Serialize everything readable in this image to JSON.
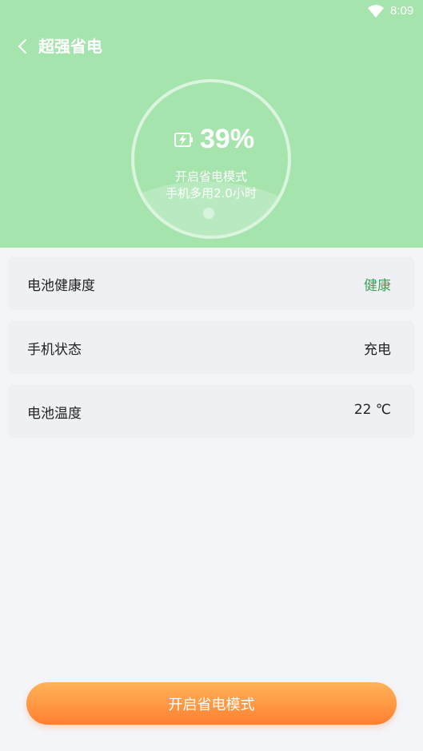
{
  "status_bar": {
    "time": "8:09",
    "wifi_icon": "wifi-icon"
  },
  "header": {
    "title": "超强省电",
    "back_icon": "chevron-left-icon",
    "background": "#a6e4ad"
  },
  "gauge": {
    "percent_text": "39%",
    "percent_value": 39,
    "icon": "battery-bolt-icon",
    "line1": "开启省电模式",
    "line2": "手机多用2.0小时"
  },
  "cards": [
    {
      "label": "电池健康度",
      "value": "健康",
      "value_color": "#3aa255"
    },
    {
      "label": "手机状态",
      "value": "充电"
    },
    {
      "label": "电池温度",
      "value": "22 ℃"
    }
  ],
  "action": {
    "label": "开启省电模式",
    "colors": [
      "#ffb35a",
      "#ff7f2f"
    ]
  }
}
